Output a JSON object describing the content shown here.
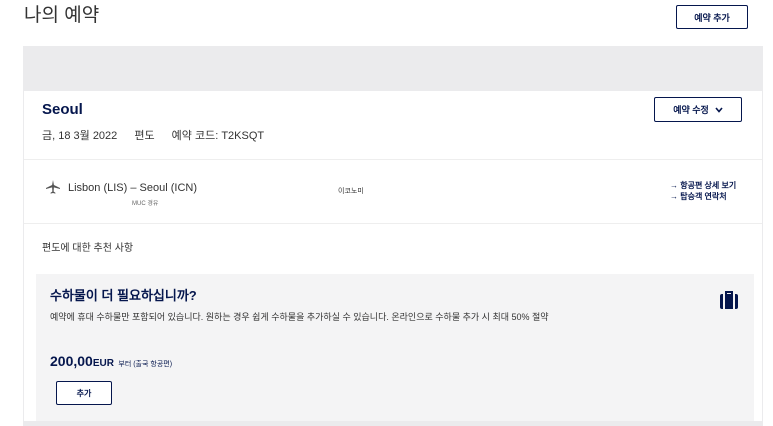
{
  "header": {
    "title": "나의 예약",
    "add_booking_label": "예약 추가"
  },
  "booking": {
    "city": "Seoul",
    "date": "금, 18 3월 2022",
    "trip_type": "편도",
    "booking_code": "예약 코드: T2KSQT",
    "edit_label": "예약 수정",
    "flight": {
      "route": "Lisbon (LIS) – Seoul (ICN)",
      "via": "MUC 경유",
      "cabin": "이코노미",
      "link_details": "→ 항공편 상세 보기",
      "link_contact": "→ 탑승객 연락처"
    },
    "recommendation_heading": "편도에 대한 추천 사항"
  },
  "offer": {
    "title": "수하물이 더 필요하십니까?",
    "description": "예약에 휴대 수하물만 포함되어 있습니다. 원하는 경우 쉽게 수하물을 추가하실 수 있습니다. 온라인으로 수하물 추가 시 최대 50% 절약",
    "price_amount": "200,00",
    "price_currency": "EUR",
    "price_suffix": "부터 (출국 항공편)",
    "add_label": "추가"
  },
  "colors": {
    "brand": "#05164d",
    "panel": "#ebebed",
    "offer_bg": "#f4f4f5"
  },
  "icons": {
    "flight": "plane-icon",
    "bag": "suitcase-icon",
    "edit": "chevron-down-icon"
  }
}
